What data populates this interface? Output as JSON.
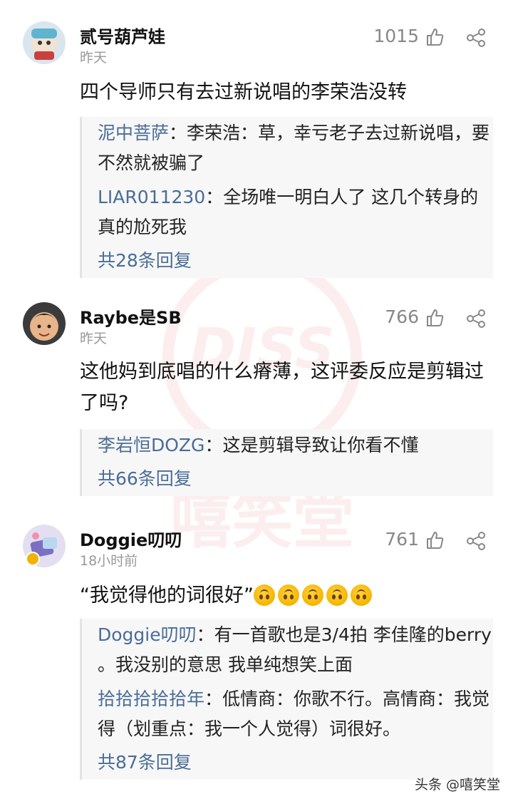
{
  "comments": [
    {
      "username": "贰号葫芦娃",
      "time": "昨天",
      "likes": "1015",
      "content": "四个导师只有去过新说唱的李荣浩没转",
      "replies": [
        {
          "author": "泥中菩萨",
          "text": "：李荣浩：草，幸亏老子去过新说唱，要不然就被骗了"
        },
        {
          "author": "LIAR011230",
          "text": "：全场唯一明白人了 这几个转身的真的尬死我"
        }
      ],
      "more": "共28条回复"
    },
    {
      "username": "Raybe是SB",
      "time": "昨天",
      "likes": "766",
      "content": "这他妈到底唱的什么瘠薄，这评委反应是剪辑过了吗?",
      "replies": [
        {
          "author": "李岩恒DOZG",
          "text": "：这是剪辑导致让你看不懂"
        }
      ],
      "more": "共66条回复"
    },
    {
      "username": "Doggie叨叨",
      "time": "18小时前",
      "likes": "761",
      "content": "“我觉得他的词很好”",
      "emoji_name": "upside-down-face",
      "emoji_count": 5,
      "replies": [
        {
          "author": "Doggie叨叨",
          "text": "：有一首歌也是3/4拍 李佳隆的berry 。我没别的意思 我单纯想笑上面"
        },
        {
          "author": "拾拾拾拾拾年",
          "text": "：低情商：你歌不行。高情商：我觉得（划重点：我一个人觉得）词很好。"
        }
      ],
      "more": "共87条回复"
    }
  ],
  "watermark": {
    "main": "嘻笑堂",
    "badge": "DISS"
  },
  "credit": "头条 @嘻笑堂",
  "colors": {
    "link": "#4a6d97",
    "muted": "#999999",
    "background": "#ffffff"
  }
}
